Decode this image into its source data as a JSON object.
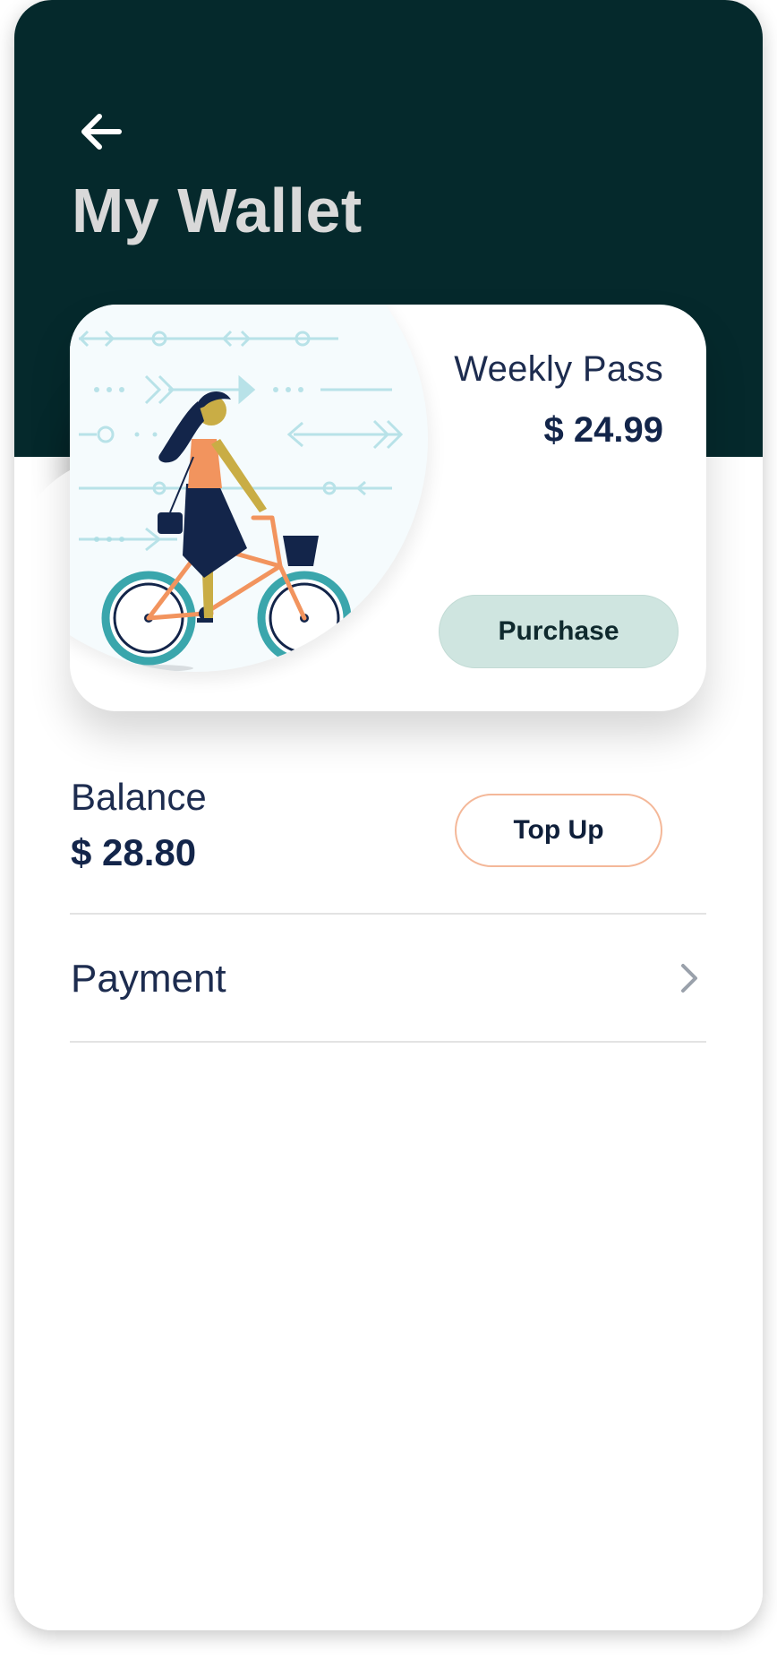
{
  "header": {
    "back_icon": "arrow-left-icon",
    "title": "My Wallet"
  },
  "pass_card": {
    "name": "Weekly Pass",
    "price": "$ 24.99",
    "purchase_label": "Purchase",
    "illustration": "woman-riding-bicycle-illustration"
  },
  "balance": {
    "label": "Balance",
    "value": "$ 28.80",
    "topup_label": "Top Up"
  },
  "payment": {
    "label": "Payment",
    "chevron_icon": "chevron-right-icon"
  },
  "colors": {
    "header_bg": "#05292c",
    "title_text": "#d9d9d9",
    "navy_text": "#13254a",
    "purchase_bg": "#cfe5e0",
    "topup_border": "#f4b899",
    "bike_frame": "#f2945e",
    "wheel_rim": "#3aa6ac"
  }
}
